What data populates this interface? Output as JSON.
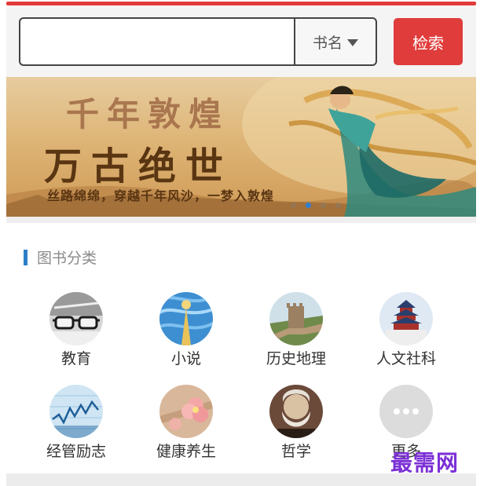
{
  "search": {
    "value": "",
    "type_label": "书名",
    "button_label": "检索"
  },
  "banner": {
    "title_line1": "千年敦煌",
    "title_line2": "万古绝世",
    "subtitle": "丝路绵绵，穿越千年风沙，一梦入敦煌",
    "slide_count": 4,
    "active_slide": 2
  },
  "categories_section": {
    "title": "图书分类",
    "items": [
      {
        "label": "教育",
        "icon": "glasses-icon"
      },
      {
        "label": "小说",
        "icon": "painted-swirl-icon"
      },
      {
        "label": "历史地理",
        "icon": "great-wall-icon"
      },
      {
        "label": "人文社科",
        "icon": "temple-of-heaven-icon"
      },
      {
        "label": "经管励志",
        "icon": "stock-chart-icon"
      },
      {
        "label": "健康养生",
        "icon": "flower-icon"
      },
      {
        "label": "哲学",
        "icon": "philosopher-portrait-icon"
      },
      {
        "label": "更多",
        "icon": "more-dots-icon"
      }
    ]
  },
  "watermark": "最需网",
  "colors": {
    "accent_red": "#e03c3c",
    "section_marker_blue": "#2c7fc9",
    "watermark_purple": "#7b2fd6"
  }
}
